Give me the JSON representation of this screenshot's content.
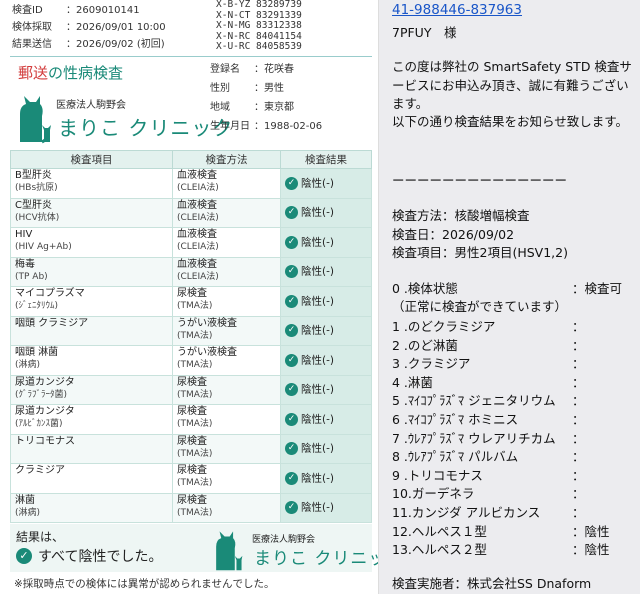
{
  "meta": {
    "rows": [
      {
        "k": "検査ID",
        "v": "：2609010141"
      },
      {
        "k": "検体採取",
        "v": "：2026/09/01 10:00"
      },
      {
        "k": "結果送信",
        "v": "：2026/09/02 (初回)"
      }
    ],
    "codes": [
      "X-B-YZ 83289739",
      "X-N-CT 83291339",
      "X-N-MG 83312338",
      "X-N-RC 84041154",
      "X-U-RC 84058539"
    ]
  },
  "title": {
    "red": "郵送",
    "rest": "の性病検査"
  },
  "brand": {
    "corp": "医療法人駒野会",
    "name": "まりこ クリニック"
  },
  "patient": [
    {
      "k": "登録名",
      "v": "：花咲春"
    },
    {
      "k": "性別",
      "v": "：男性"
    },
    {
      "k": "地域",
      "v": "：東京都"
    },
    {
      "k": "生年月日",
      "v": "：1988-02-06"
    }
  ],
  "table": {
    "headers": [
      "検査項目",
      "検査方法",
      "検査結果"
    ],
    "rows": [
      {
        "item": "B型肝炎",
        "item_sub": "(HBs抗原)",
        "method": "血液検査",
        "method_sub": "(CLEIA法)",
        "result": "陰性(-)"
      },
      {
        "item": "C型肝炎",
        "item_sub": "(HCV抗体)",
        "method": "血液検査",
        "method_sub": "(CLEIA法)",
        "result": "陰性(-)"
      },
      {
        "item": "HIV",
        "item_sub": "(HIV Ag+Ab)",
        "method": "血液検査",
        "method_sub": "(CLEIA法)",
        "result": "陰性(-)"
      },
      {
        "item": "梅毒",
        "item_sub": "(TP Ab)",
        "method": "血液検査",
        "method_sub": "(CLEIA法)",
        "result": "陰性(-)"
      },
      {
        "item": "マイコプラズマ",
        "item_sub": "(ｼﾞｪﾆﾀﾘｳﾑ)",
        "method": "尿検査",
        "method_sub": "(TMA法)",
        "result": "陰性(-)"
      },
      {
        "item": "咽頭 クラミジア",
        "item_sub": "",
        "method": "うがい液検査",
        "method_sub": "(TMA法)",
        "result": "陰性(-)"
      },
      {
        "item": "咽頭 淋菌",
        "item_sub": "(淋病)",
        "method": "うがい液検査",
        "method_sub": "(TMA法)",
        "result": "陰性(-)"
      },
      {
        "item": "尿道カンジタ",
        "item_sub": "(ｸﾞﾗﾌﾞﾗｰﾀ菌)",
        "method": "尿検査",
        "method_sub": "(TMA法)",
        "result": "陰性(-)"
      },
      {
        "item": "尿道カンジタ",
        "item_sub": "(ｱﾙﾋﾞｶﾝｽ菌)",
        "method": "尿検査",
        "method_sub": "(TMA法)",
        "result": "陰性(-)"
      },
      {
        "item": "トリコモナス",
        "item_sub": "",
        "method": "尿検査",
        "method_sub": "(TMA法)",
        "result": "陰性(-)"
      },
      {
        "item": "クラミジア",
        "item_sub": "",
        "method": "尿検査",
        "method_sub": "(TMA法)",
        "result": "陰性(-)"
      },
      {
        "item": "淋菌",
        "item_sub": "(淋病)",
        "method": "尿検査",
        "method_sub": "(TMA法)",
        "result": "陰性(-)"
      }
    ]
  },
  "summary": {
    "line1": "結果は、",
    "line2": "すべて陰性でした。"
  },
  "footnote": "※採取時点での検体には異常が認められませんでした。",
  "message": {
    "link": "41-988446-837963",
    "to": "7PFUY　様",
    "intro": "この度は弊社の SmartSafety STD 検査サービスにお申込み頂き、誠に有難うございます。",
    "notice": "以下の通り検査結果をお知らせ致します。",
    "divider": "ーーーーーーーーーーーーーー",
    "method": "検査方法：核酸増幅検査",
    "date": "検査日：2026/09/02",
    "items": "検査項目：男性2項目(HSV1,2)",
    "status_label": "0 .検体状態",
    "status_value": "：検査可",
    "status_note": "（正常に検査ができています）",
    "list": [
      {
        "label": "1 .のどクラミジア",
        "value": "："
      },
      {
        "label": "2 .のど淋菌",
        "value": "："
      },
      {
        "label": "3 .クラミジア",
        "value": "："
      },
      {
        "label": "4 .淋菌",
        "value": "："
      },
      {
        "label": "5 .ﾏｲｺﾌﾟﾗｽﾞﾏ ジェニタリウム",
        "value": "："
      },
      {
        "label": "6 .ﾏｲｺﾌﾟﾗｽﾞﾏ ホミニス",
        "value": "："
      },
      {
        "label": "7 .ｳﾚｱﾌﾟﾗｽﾞﾏ ウレアリチカム",
        "value": "："
      },
      {
        "label": "8 .ｳﾚｱﾌﾟﾗｽﾞﾏ パルバム",
        "value": "："
      },
      {
        "label": "9 .トリコモナス",
        "value": "："
      },
      {
        "label": "10.ガーデネラ",
        "value": "："
      },
      {
        "label": "11.カンジダ アルビカンス",
        "value": "："
      },
      {
        "label": "12.ヘルペス１型",
        "value": "：陰性"
      },
      {
        "label": "13.ヘルペス２型",
        "value": "：陰性"
      }
    ],
    "provider": "検査実施者：株式会社SS Dnaform"
  },
  "icons": {
    "check": "check-circle-icon",
    "mascot": "cat-logo-icon"
  },
  "colors": {
    "brand": "#1a8a78",
    "accent_red": "#d23c3c",
    "link": "#1a56c8"
  }
}
